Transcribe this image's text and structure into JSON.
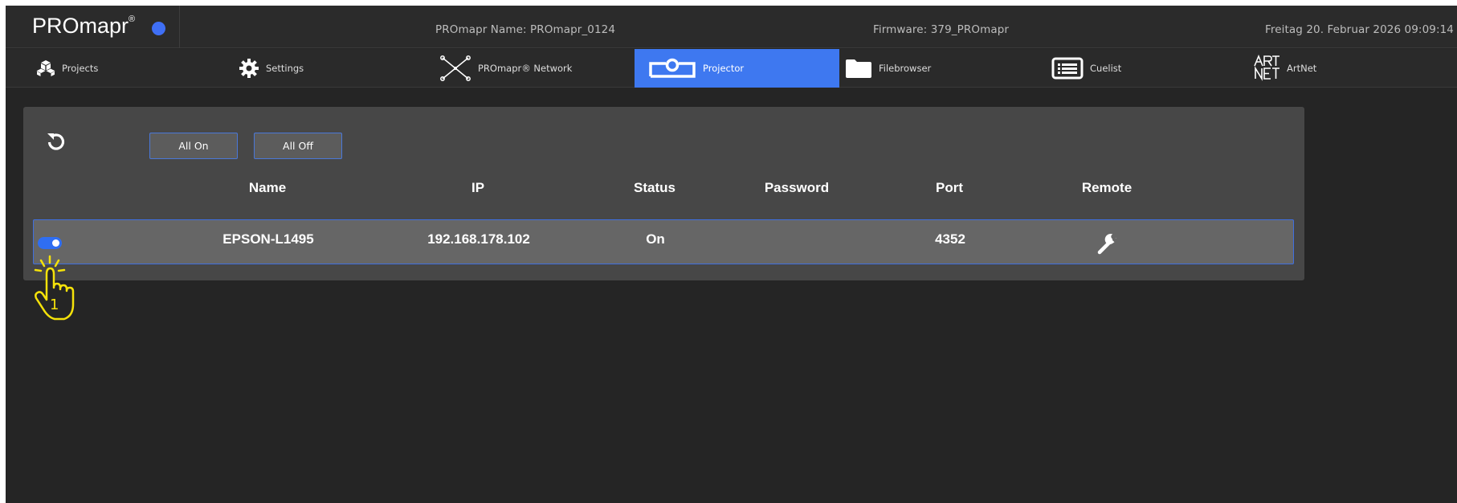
{
  "topbar": {
    "brand": "PROmapr",
    "brand_reg": "®",
    "promapr_name": "PROmapr Name: PROmapr_0124",
    "firmware": "Firmware: 379_PROmapr",
    "datetime": "Freitag 20. Februar 2026 09:09:14",
    "status_color": "#3f6ff5"
  },
  "nav": {
    "items": [
      {
        "label": "Projects",
        "icon": "cubes-icon"
      },
      {
        "label": "Settings",
        "icon": "gear-icon"
      },
      {
        "label": "PROmapr® Network",
        "icon": "network-icon"
      },
      {
        "label": "Projector",
        "icon": "projector-icon",
        "active": true
      },
      {
        "label": "Filebrowser",
        "icon": "folder-icon"
      },
      {
        "label": "Cuelist",
        "icon": "list-icon"
      },
      {
        "label": "ArtNet",
        "icon": "artnet-logo-icon"
      }
    ],
    "active_color": "#3e78f0"
  },
  "panel": {
    "all_on": "All On",
    "all_off": "All Off",
    "columns": [
      "Name",
      "IP",
      "Status",
      "Password",
      "Port",
      "Remote"
    ],
    "rows": [
      {
        "enabled": true,
        "name": "EPSON-L1495",
        "ip": "192.168.178.102",
        "status": "On",
        "password": "",
        "port": "4352",
        "remote": "wrench-icon"
      }
    ]
  },
  "annotation": {
    "step": "1",
    "color": "#f5e20a"
  }
}
